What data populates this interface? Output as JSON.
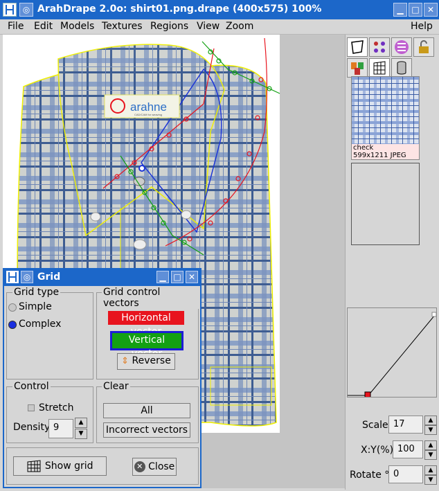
{
  "window": {
    "title": "ArahDrape 2.0o: shirt01.png.drape (400x575) 100%"
  },
  "menu": {
    "items": [
      "File",
      "Edit",
      "Models",
      "Textures",
      "Regions",
      "View",
      "Zoom",
      "Help"
    ]
  },
  "canvas": {
    "logo_text": "arahne",
    "logo_sub": "CAD/CAM for weaving"
  },
  "texture": {
    "name": "check",
    "info": "599x1211 JPEG"
  },
  "fields": {
    "scale_label": "Scale",
    "scale_value": "17",
    "xy_label": "X:Y(%)",
    "xy_value": "100",
    "rotate_label": "Rotate °",
    "rotate_value": "0"
  },
  "dialog": {
    "title": "Grid",
    "grid_type": {
      "legend": "Grid type",
      "simple": "Simple",
      "complex": "Complex",
      "selected": "Complex"
    },
    "vectors": {
      "legend": "Grid control vectors",
      "horizontal": "Horizontal vector",
      "vertical": "Vertical vector",
      "reverse": "Reverse"
    },
    "control": {
      "legend": "Control",
      "stretch": "Stretch",
      "density_label": "Density",
      "density_value": "9"
    },
    "clear": {
      "legend": "Clear",
      "all": "All",
      "incorrect": "Incorrect vectors"
    },
    "show_grid": "Show grid",
    "close": "Close"
  },
  "colors": {
    "accent": "#1c67c9",
    "horizontal": "#e8141e",
    "vertical": "#13a013"
  }
}
